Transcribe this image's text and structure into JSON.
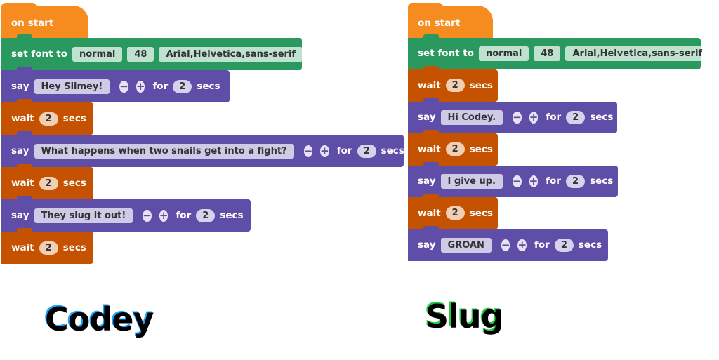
{
  "colors": {
    "event": "#f68b1f",
    "font": "#2a9960",
    "say": "#5f4ea8",
    "wait": "#c55200"
  },
  "labels": {
    "on_start": "on start",
    "set_font_to": "set font to",
    "say": "say",
    "for": "for",
    "secs": "secs",
    "wait": "wait",
    "minus": "−",
    "plus": "+"
  },
  "codey": {
    "title": "Codey",
    "title_shadow": "#1aa3ff",
    "blocks": [
      {
        "type": "hat"
      },
      {
        "type": "font",
        "style": "normal",
        "size": "48",
        "family": "Arial,Helvetica,sans-serif"
      },
      {
        "type": "say",
        "text": "Hey Slimey!",
        "secs": "2"
      },
      {
        "type": "wait",
        "secs": "2"
      },
      {
        "type": "say",
        "text": "What happens when two snails get into a fight?",
        "secs": "2"
      },
      {
        "type": "wait",
        "secs": "2"
      },
      {
        "type": "say",
        "text": "They slug it out!",
        "secs": "2"
      },
      {
        "type": "wait",
        "secs": "2"
      }
    ]
  },
  "slug": {
    "title": "Slug",
    "title_shadow": "#22cc44",
    "blocks": [
      {
        "type": "hat"
      },
      {
        "type": "font",
        "style": "normal",
        "size": "48",
        "family": "Arial,Helvetica,sans-serif"
      },
      {
        "type": "wait",
        "secs": "2"
      },
      {
        "type": "say",
        "text": "Hi Codey.",
        "secs": "2"
      },
      {
        "type": "wait",
        "secs": "2"
      },
      {
        "type": "say",
        "text": "I give up.",
        "secs": "2"
      },
      {
        "type": "wait",
        "secs": "2"
      },
      {
        "type": "say",
        "text": "GROAN",
        "secs": "2"
      }
    ]
  }
}
